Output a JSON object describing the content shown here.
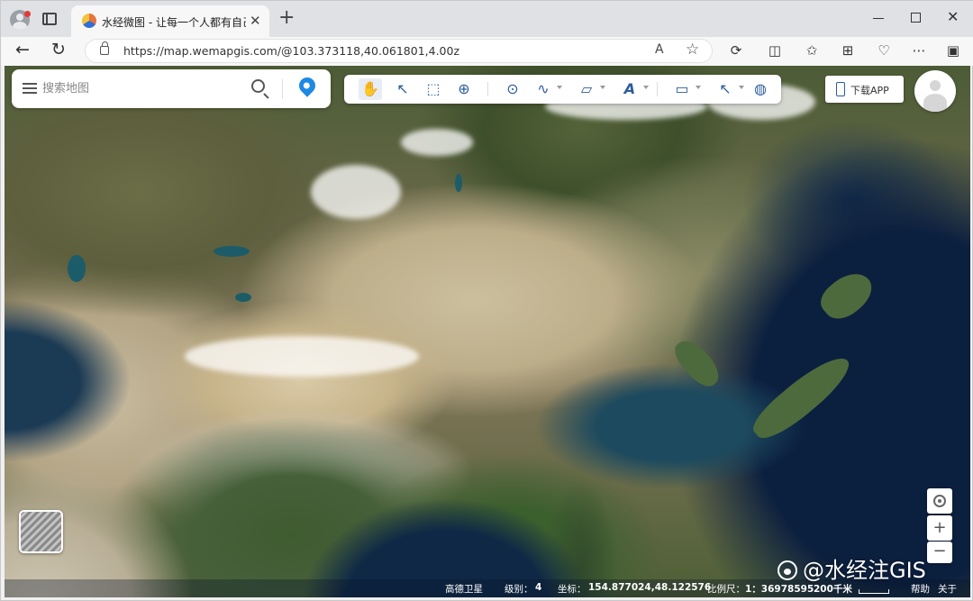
{
  "browser": {
    "tab_title": "水经微图 - 让每一个人都有自己的",
    "tab_close": "✕",
    "new_tab": "+",
    "window_close": "✕",
    "back": "←",
    "reload": "↻",
    "url": "https://map.wemapgis.com/@103.373118,40.061801,4.00z",
    "read_aloud": "A",
    "favorite": "☆",
    "icons": [
      "extensions-icon",
      "split-screen-icon",
      "favorites-icon",
      "collections-icon",
      "browser-essentials-icon",
      "more-icon",
      "sidebar-icon"
    ],
    "icon_glyphs": [
      "⟳",
      "◫",
      "✩",
      "⊞",
      "♡",
      "⋯",
      "▣"
    ]
  },
  "search": {
    "placeholder": "搜索地图"
  },
  "map_tools": [
    {
      "name": "pan-tool",
      "glyph": "✋"
    },
    {
      "name": "select-tool",
      "glyph": "↖"
    },
    {
      "name": "box-select-tool",
      "glyph": "⬚"
    },
    {
      "name": "zoom-box-tool",
      "glyph": "⊕"
    },
    {
      "name": "marker-tool",
      "glyph": "⊙"
    },
    {
      "name": "line-tool",
      "glyph": "∿"
    },
    {
      "name": "polygon-tool",
      "glyph": "▱"
    },
    {
      "name": "text-tool",
      "glyph": "A"
    },
    {
      "name": "measure-tool",
      "glyph": "▭"
    },
    {
      "name": "identify-tool",
      "glyph": "↖"
    },
    {
      "name": "globe-tool",
      "glyph": "◍"
    }
  ],
  "download_app": "下载APP",
  "zoom": {
    "in": "+",
    "out": "−"
  },
  "status": {
    "basemap": "高德卫星",
    "level_label": "级别：",
    "level": "4",
    "coord_label": "坐标：",
    "coord": "154.877024,48.122576",
    "scale_label": "比例尺：",
    "scale": "1：36978595",
    "distance": "200千米",
    "help": "帮助",
    "about": "关于"
  },
  "watermark": "@水经注GIS"
}
